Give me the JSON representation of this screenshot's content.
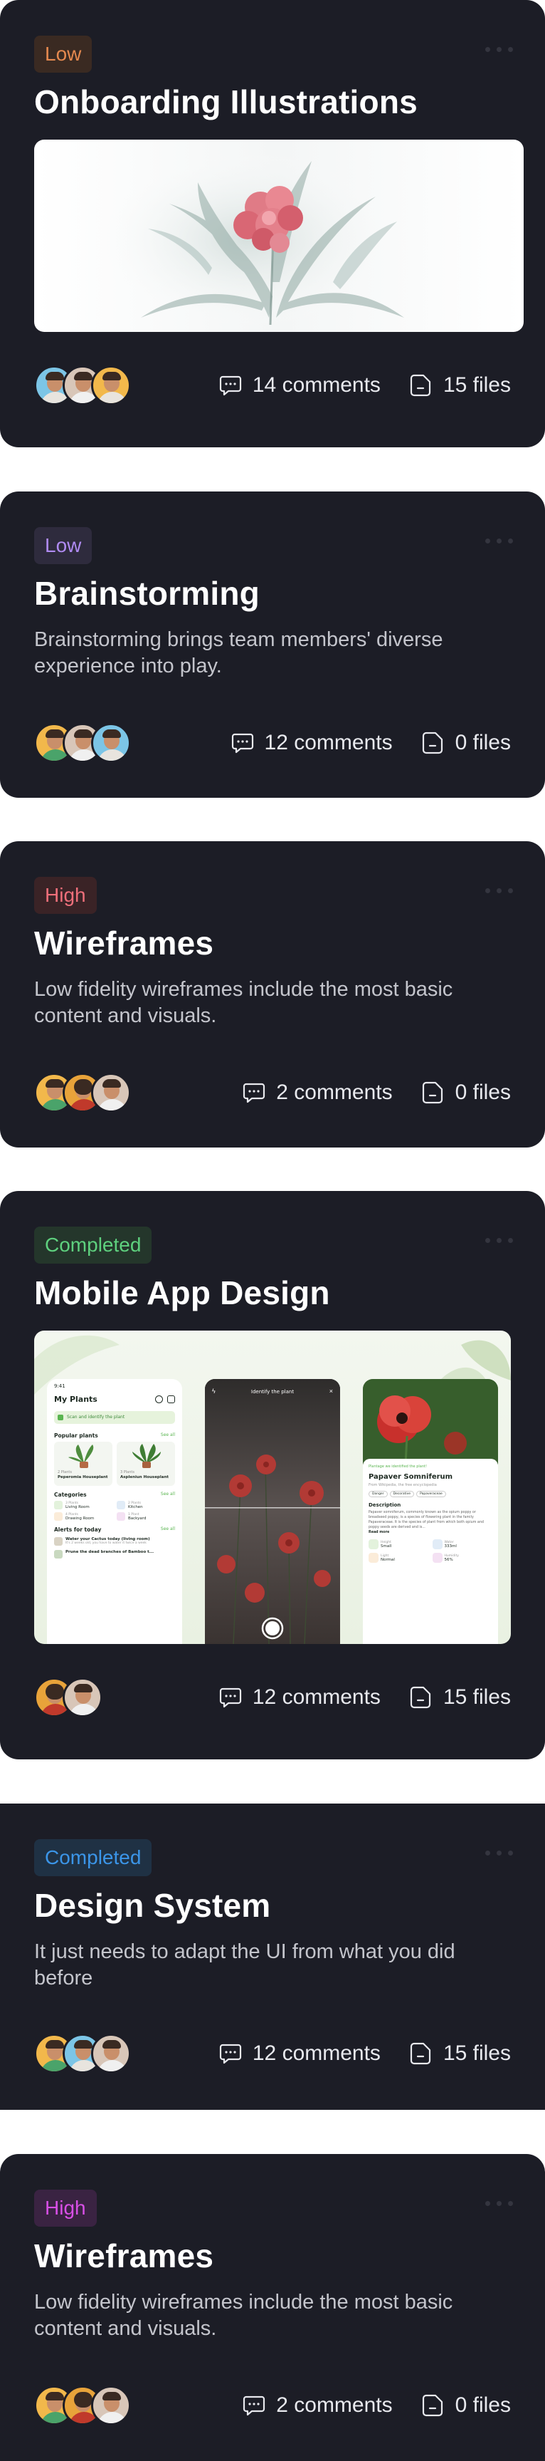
{
  "cards": [
    {
      "tag": "Low",
      "tag_colors": {
        "bg": "#3a2a22",
        "fg": "#e5894f"
      },
      "title": "Onboarding Illustrations",
      "comments": "14 comments",
      "files": "15 files"
    },
    {
      "tag": "Low",
      "tag_colors": {
        "bg": "#2e2b3d",
        "fg": "#b08bf2"
      },
      "title": "Brainstorming",
      "description": "Brainstorming brings team members' diverse experience into play.",
      "comments": "12 comments",
      "files": "0 files"
    },
    {
      "tag": "High",
      "tag_colors": {
        "bg": "#3a2326",
        "fg": "#ee6f7a"
      },
      "title": "Wireframes",
      "description": "Low fidelity wireframes include the most basic content and visuals.",
      "comments": "2 comments",
      "files": "0 files"
    },
    {
      "tag": "Completed",
      "tag_colors": {
        "bg": "#24362b",
        "fg": "#5ed07e"
      },
      "title": "Mobile App Design",
      "comments": "12 comments",
      "files": "15 files",
      "phones": {
        "status_time": "9:41",
        "left": {
          "title": "My Plants",
          "banner": "Scan and identify the plant",
          "popular": "Popular plants",
          "see_all": "See all",
          "plant1_type": "2 Plants",
          "plant1": "Peperomia Houseplant",
          "plant2_type": "3 Plants",
          "plant2": "Aspleniun Houseplant",
          "categories": "Categories",
          "cat1_count": "3 Plants",
          "cat1": "Living Room",
          "cat2_count": "2 Plants",
          "cat2": "Kitchen",
          "cat3_count": "4 Plants",
          "cat3": "Drawing Room",
          "cat4_count": "1 Plant",
          "cat4": "Backyard",
          "alerts": "Alerts for today",
          "alert1": "Water your Cactus today (living room)",
          "alert1_time": "It's 2 weeks old, you have to water it twice a week",
          "alert2": "Prune the dead branches of Bamboo t..."
        },
        "middle": {
          "title": "Identify the plant"
        },
        "right": {
          "found": "Plantage we identified the plant!",
          "name": "Papaver Somniferum",
          "from": "From Wikipedia, the free encyclopedia",
          "chip1": "Danger",
          "chip2": "Decorative",
          "chip3": "Papaveraceae",
          "description_label": "Description",
          "description": "Papaver somniferum, commonly known as the opium poppy or breadseed poppy, is a species of flowering plant in the family Papaveraceae. It is the species of plant from which both opium and poppy seeds are derived and is...",
          "read_more": "Read more",
          "stat1_label": "Height",
          "stat1_value": "Small",
          "stat2_label": "Water",
          "stat2_value": "333ml",
          "stat3_label": "Light",
          "stat3_value": "Normal",
          "stat4_label": "Humidity",
          "stat4_value": "56%"
        }
      }
    },
    {
      "tag": "Completed",
      "tag_colors": {
        "bg": "#1f3144",
        "fg": "#3b95e8"
      },
      "title": "Design System",
      "description": "It just needs to adapt the UI from what you did before",
      "comments": "12 comments",
      "files": "15 files"
    },
    {
      "tag": "High",
      "tag_colors": {
        "bg": "#3a2342",
        "fg": "#d84fe6"
      },
      "title": "Wireframes",
      "description": "Low fidelity wireframes include the most basic content and visuals.",
      "comments": "2 comments",
      "files": "0 files"
    }
  ]
}
